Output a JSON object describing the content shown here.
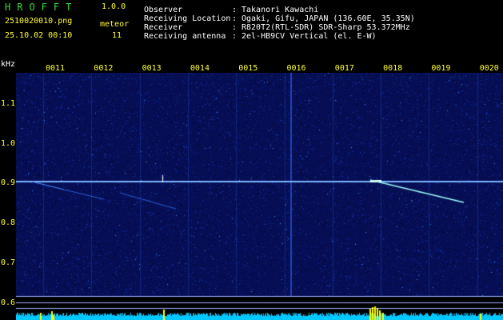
{
  "header": {
    "app_name": "HROFFT",
    "app_version": "1.0.0",
    "file_name": "2510020010.png",
    "datetime": "25.10.02 00:10",
    "meteor_label": "meteor",
    "meteor_count": "11"
  },
  "station": [
    {
      "label": "Observer",
      "value": "Takanori Kawachi"
    },
    {
      "label": "Receiving Location",
      "value": "Ogaki, Gifu, JAPAN (136.60E, 35.35N)"
    },
    {
      "label": "Receiver",
      "value": "R820T2(RTL-SDR) SDR-Sharp 53.372MHz"
    },
    {
      "label": "Receiving antenna",
      "value": "2el-HB9CV Vertical (el. E-W)"
    }
  ],
  "spectrogram": {
    "unit_label": "kHz",
    "time_labels": [
      "0011",
      "0012",
      "0013",
      "0014",
      "0015",
      "0016",
      "0017",
      "0018",
      "0019",
      "0020"
    ],
    "freq_labels": [
      "1.1",
      "1.0",
      "0.9",
      "0.8",
      "0.7",
      "0.6"
    ]
  },
  "colors": {
    "background": "#000000",
    "waterfall_noise": "#0a1a7a",
    "carrier_line": "#7fb4ff",
    "meteor_trace": "#9ffcff",
    "level_bars": "#00c8ff",
    "level_peak": "#ffff00",
    "header_text": "#ffffff",
    "label_text": "#ffff33",
    "title_text": "#33dd33"
  }
}
